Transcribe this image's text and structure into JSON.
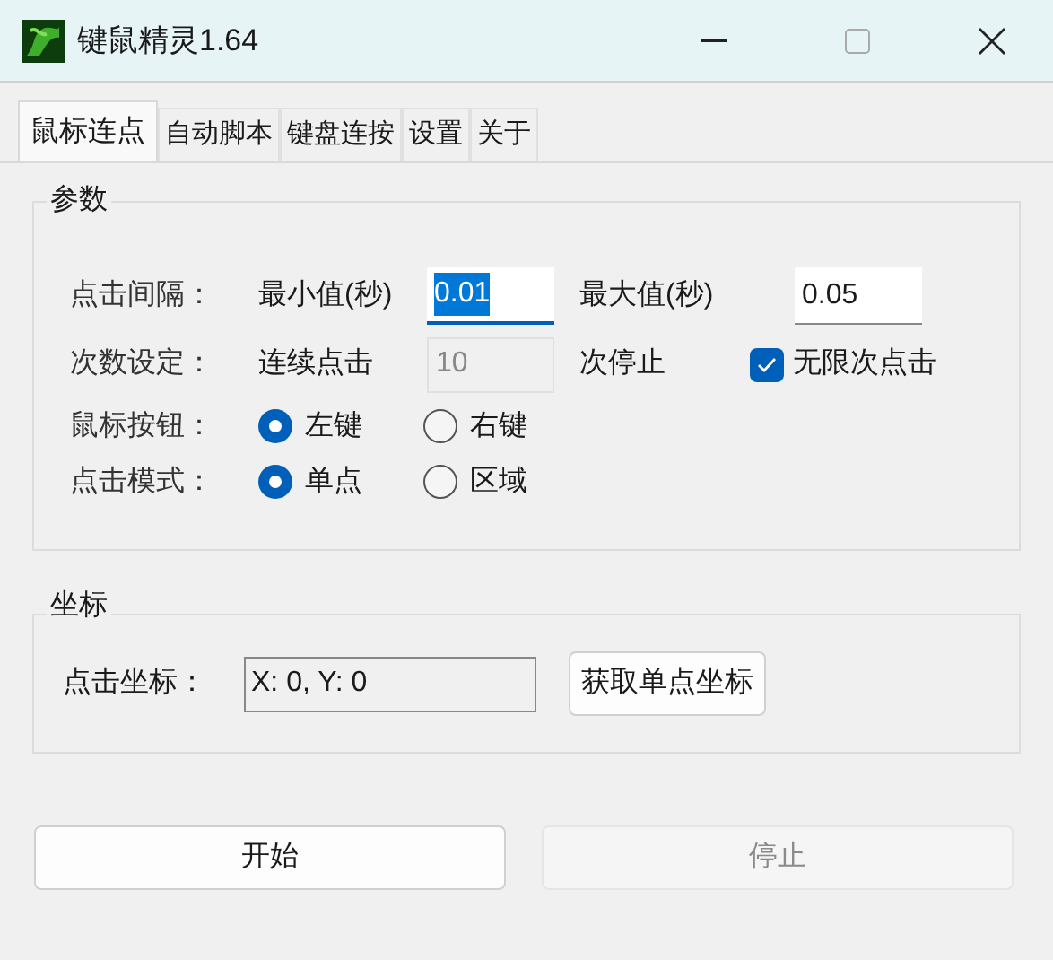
{
  "window": {
    "title": "键鼠精灵1.64"
  },
  "tabs": [
    {
      "label": "鼠标连点",
      "selected": true
    },
    {
      "label": "自动脚本",
      "selected": false
    },
    {
      "label": "键盘连按",
      "selected": false
    },
    {
      "label": "设置",
      "selected": false
    },
    {
      "label": "关于",
      "selected": false
    }
  ],
  "params": {
    "title": "参数",
    "interval": {
      "label": "点击间隔：",
      "min_label": "最小值(秒)",
      "min_value": "0.01",
      "min_focused": true,
      "max_label": "最大值(秒)",
      "max_value": "0.05"
    },
    "count": {
      "label": "次数设定：",
      "prefix": "连续点击",
      "value": "10",
      "disabled": true,
      "suffix": "次停止",
      "checkbox": {
        "label": "无限次点击",
        "checked": true
      }
    },
    "radios": [
      {
        "label": "鼠标按钮：",
        "options": [
          {
            "label": "左键",
            "selected": true
          },
          {
            "label": "右键",
            "selected": false
          }
        ]
      },
      {
        "label": "点击模式：",
        "options": [
          {
            "label": "单点",
            "selected": true
          },
          {
            "label": "区域",
            "selected": false
          }
        ]
      }
    ]
  },
  "coords": {
    "title": "坐标",
    "label": "点击坐标：",
    "value": "X: 0, Y: 0",
    "button": "获取单点坐标"
  },
  "buttons": [
    {
      "label": "开始",
      "disabled": false
    },
    {
      "label": "停止",
      "disabled": true
    }
  ]
}
